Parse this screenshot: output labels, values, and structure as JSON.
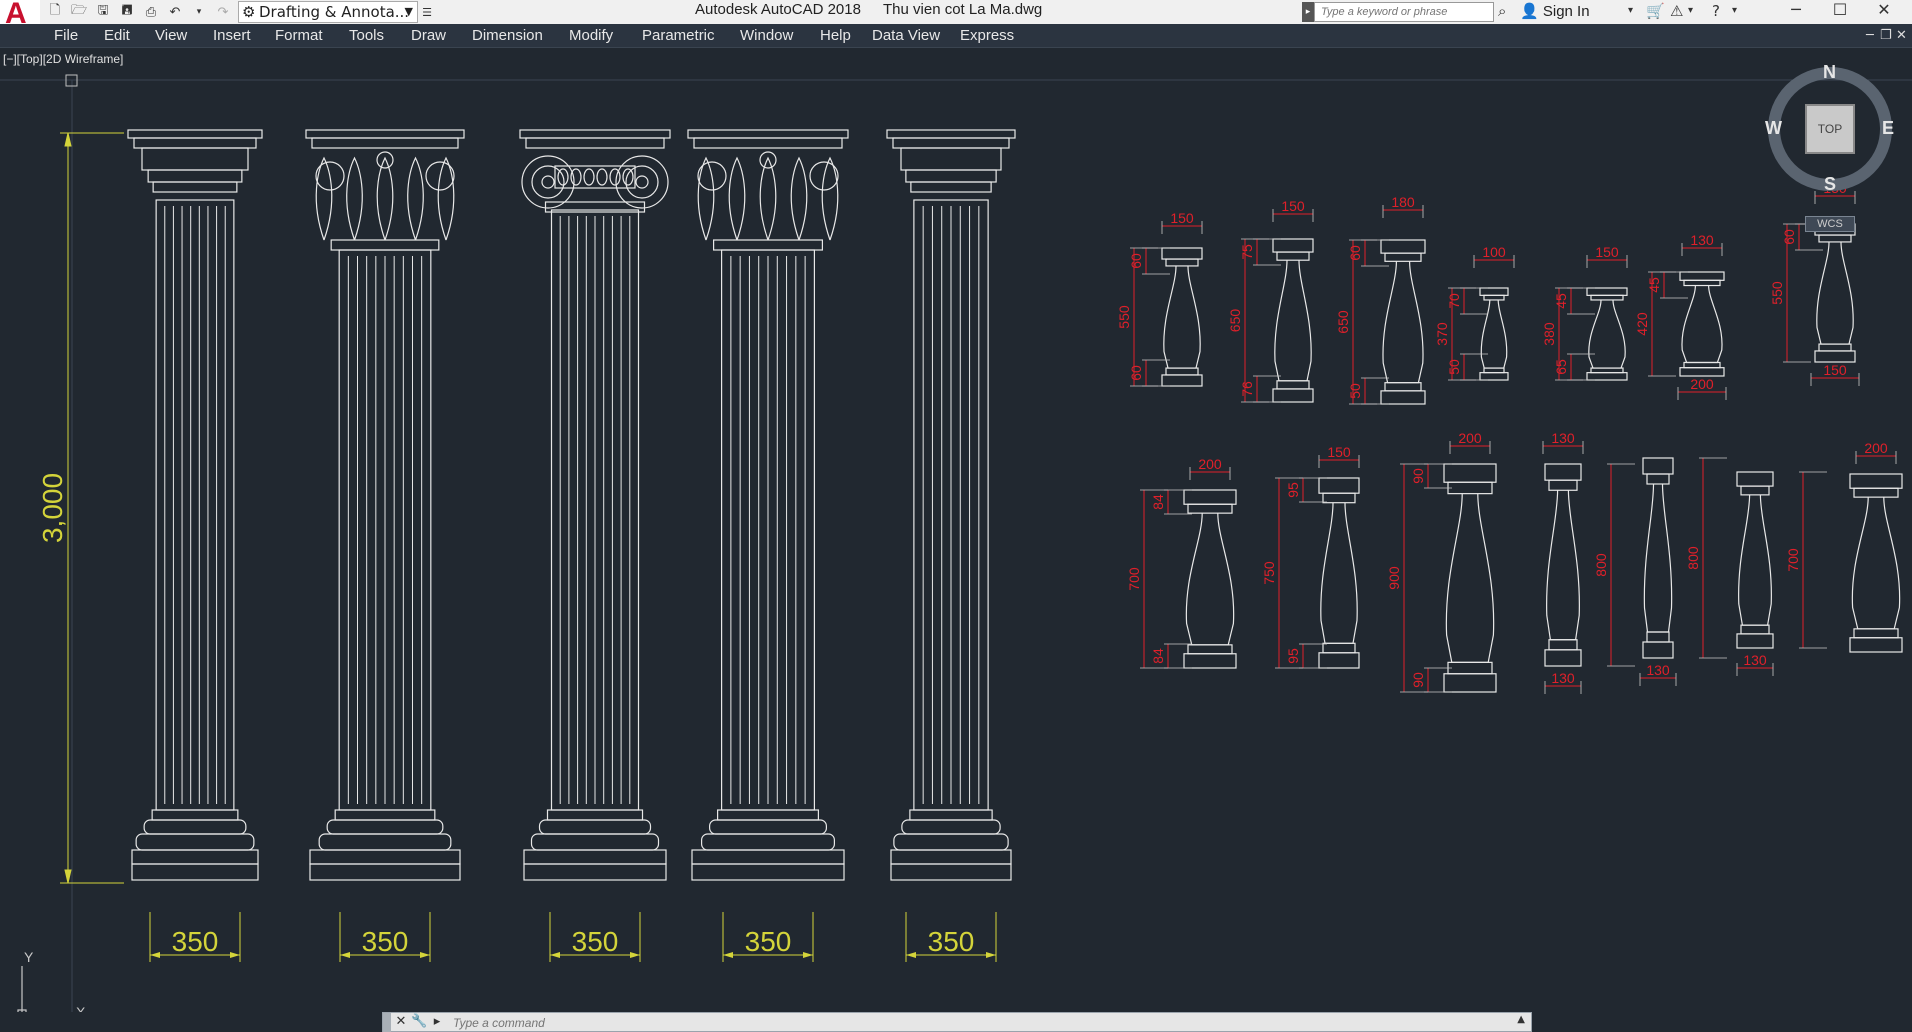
{
  "app": {
    "logo_letter": "A",
    "title": "Autodesk AutoCAD 2018",
    "file_name": "Thu vien cot La Ma.dwg",
    "workspace": "Drafting & Annota...",
    "search_placeholder": "Type a keyword or phrase",
    "sign_in": "Sign In"
  },
  "menu": [
    "File",
    "Edit",
    "View",
    "Insert",
    "Format",
    "Tools",
    "Draw",
    "Dimension",
    "Modify",
    "Parametric",
    "Window",
    "Help",
    "Data View",
    "Express"
  ],
  "viewport": {
    "label": "[−][Top][2D Wireframe]"
  },
  "viewcube": {
    "north": "N",
    "south": "S",
    "east": "E",
    "west": "W",
    "top": "TOP",
    "wcs": "WCS"
  },
  "ucs": {
    "x": "X",
    "y": "Y"
  },
  "command": {
    "placeholder": "Type a command"
  },
  "drawing": {
    "height_dim": "3,000",
    "column_widths": [
      "350",
      "350",
      "350",
      "350",
      "350"
    ],
    "baluster_row1": {
      "widths": [
        "150",
        "150",
        "180",
        "100",
        "150",
        "130",
        "130"
      ],
      "heights": [
        "550",
        "650",
        "650",
        "370",
        "380",
        "420",
        "550"
      ],
      "tops": [
        "60",
        "75",
        "60",
        "70",
        "45",
        "45",
        "60"
      ],
      "bottoms": [
        "60",
        "76",
        "50",
        "50",
        "65",
        "",
        ""
      ],
      "base_widths": [
        "",
        "",
        "",
        "",
        "",
        "200",
        "150"
      ]
    },
    "baluster_row2": {
      "widths": [
        "200",
        "150",
        "200",
        "130",
        "",
        "",
        "200"
      ],
      "heights": [
        "700",
        "750",
        "900",
        "800",
        "800",
        "700"
      ],
      "tops": [
        "84",
        "95",
        "90"
      ],
      "bottoms": [
        "84",
        "95",
        "90"
      ],
      "base_widths": [
        "130",
        "130",
        "130"
      ]
    }
  },
  "colors": {
    "background": "#212830",
    "linework": "#e8e8e8",
    "dimension_yellow": "#d4d43a",
    "dimension_red": "#e0202a"
  }
}
